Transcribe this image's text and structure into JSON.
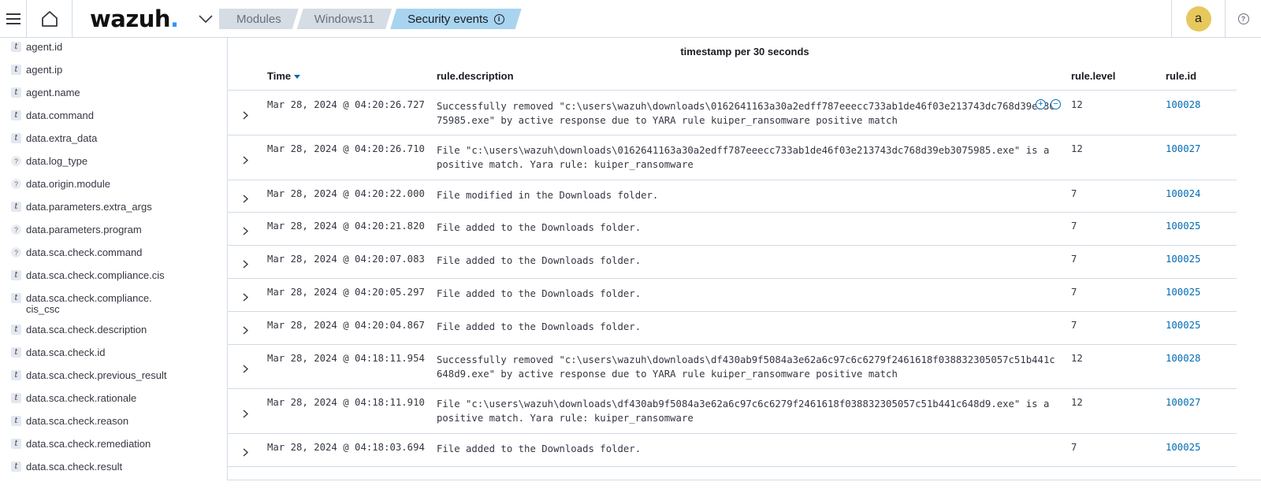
{
  "header": {
    "logo_text": "wazuh",
    "logo_dot": ".",
    "breadcrumbs": [
      "Modules",
      "Windows11",
      "Security events"
    ],
    "avatar_initial": "a",
    "help_symbol": "?",
    "icons": [
      "menu-icon",
      "home-icon",
      "chevron-down-icon",
      "info-icon",
      "help-icon"
    ],
    "accent_color": "#3595f9",
    "active_crumb_color": "#a8d4f0",
    "avatar_color": "#e7c85c"
  },
  "sidebar": {
    "fields": [
      {
        "type": "t",
        "name": "agent.id"
      },
      {
        "type": "t",
        "name": "agent.ip"
      },
      {
        "type": "t",
        "name": "agent.name"
      },
      {
        "type": "t",
        "name": "data.command"
      },
      {
        "type": "t",
        "name": "data.extra_data"
      },
      {
        "type": "?",
        "name": "data.log_type"
      },
      {
        "type": "?",
        "name": "data.origin.module"
      },
      {
        "type": "t",
        "name": "data.parameters.extra_args"
      },
      {
        "type": "?",
        "name": "data.parameters.program"
      },
      {
        "type": "?",
        "name": "data.sca.check.command"
      },
      {
        "type": "t",
        "name": "data.sca.check.compliance.cis"
      },
      {
        "type": "t",
        "name": "data.sca.check.compliance.\ncis_csc"
      },
      {
        "type": "t",
        "name": "data.sca.check.description"
      },
      {
        "type": "t",
        "name": "data.sca.check.id"
      },
      {
        "type": "t",
        "name": "data.sca.check.previous_result"
      },
      {
        "type": "t",
        "name": "data.sca.check.rationale"
      },
      {
        "type": "t",
        "name": "data.sca.check.reason"
      },
      {
        "type": "t",
        "name": "data.sca.check.remediation"
      },
      {
        "type": "t",
        "name": "data.sca.check.result"
      }
    ]
  },
  "main": {
    "chart_caption": "timestamp per 30 seconds",
    "columns": {
      "time": "Time",
      "description": "rule.description",
      "level": "rule.level",
      "id": "rule.id"
    },
    "rows": [
      {
        "time": "Mar 28, 2024 @ 04:20:26.727",
        "description": "Successfully removed \"c:\\users\\wazuh\\downloads\\0162641163a30a2edff787eeecc733ab1de46f03e213743dc768d39eb3075985.exe\" by active response due to YARA rule kuiper_ransomware positive match",
        "level": "12",
        "id": "100028"
      },
      {
        "time": "Mar 28, 2024 @ 04:20:26.710",
        "description": "File \"c:\\users\\wazuh\\downloads\\0162641163a30a2edff787eeecc733ab1de46f03e213743dc768d39eb3075985.exe\" is a positive match. Yara rule: kuiper_ransomware",
        "level": "12",
        "id": "100027"
      },
      {
        "time": "Mar 28, 2024 @ 04:20:22.000",
        "description": "File modified in the Downloads folder.",
        "level": "7",
        "id": "100024"
      },
      {
        "time": "Mar 28, 2024 @ 04:20:21.820",
        "description": "File added to the Downloads folder.",
        "level": "7",
        "id": "100025"
      },
      {
        "time": "Mar 28, 2024 @ 04:20:07.083",
        "description": "File added to the Downloads folder.",
        "level": "7",
        "id": "100025"
      },
      {
        "time": "Mar 28, 2024 @ 04:20:05.297",
        "description": "File added to the Downloads folder.",
        "level": "7",
        "id": "100025"
      },
      {
        "time": "Mar 28, 2024 @ 04:20:04.867",
        "description": "File added to the Downloads folder.",
        "level": "7",
        "id": "100025"
      },
      {
        "time": "Mar 28, 2024 @ 04:18:11.954",
        "description": "Successfully removed \"c:\\users\\wazuh\\downloads\\df430ab9f5084a3e62a6c97c6c6279f2461618f038832305057c51b441c648d9.exe\" by active response due to YARA rule kuiper_ransomware positive match",
        "level": "12",
        "id": "100028"
      },
      {
        "time": "Mar 28, 2024 @ 04:18:11.910",
        "description": "File \"c:\\users\\wazuh\\downloads\\df430ab9f5084a3e62a6c97c6c6279f2461618f038832305057c51b441c648d9.exe\" is a positive match. Yara rule: kuiper_ransomware",
        "level": "12",
        "id": "100027"
      },
      {
        "time": "Mar 28, 2024 @ 04:18:03.694",
        "description": "File added to the Downloads folder.",
        "level": "7",
        "id": "100025"
      }
    ]
  },
  "cell_actions": {
    "filter_in": "+",
    "filter_out": "−"
  }
}
